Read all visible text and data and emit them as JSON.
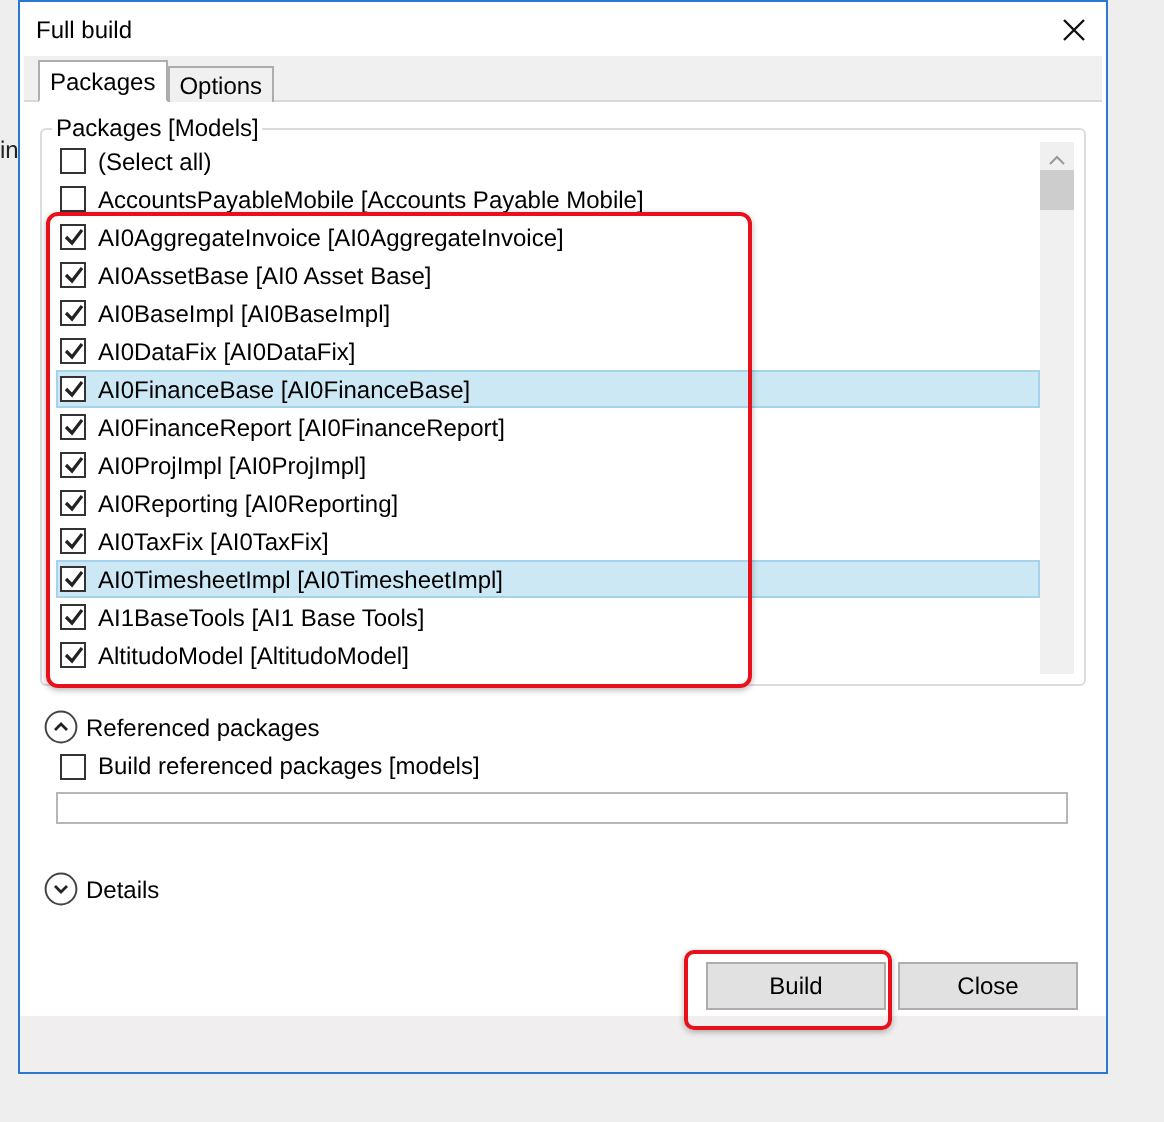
{
  "background": {
    "text": "in"
  },
  "window": {
    "title": "Full build"
  },
  "tabs": [
    {
      "label": "Packages",
      "selected": true
    },
    {
      "label": "Options",
      "selected": false
    }
  ],
  "packages": {
    "title": "Packages [Models]",
    "items": [
      {
        "label": "(Select all)",
        "checked": false,
        "selected": false
      },
      {
        "label": "AccountsPayableMobile [Accounts Payable Mobile]",
        "checked": false,
        "selected": false
      },
      {
        "label": "AI0AggregateInvoice [AI0AggregateInvoice]",
        "checked": true,
        "selected": false
      },
      {
        "label": "AI0AssetBase [AI0 Asset Base]",
        "checked": true,
        "selected": false
      },
      {
        "label": "AI0BaseImpl [AI0BaseImpl]",
        "checked": true,
        "selected": false
      },
      {
        "label": "AI0DataFix [AI0DataFix]",
        "checked": true,
        "selected": false
      },
      {
        "label": "AI0FinanceBase [AI0FinanceBase]",
        "checked": true,
        "selected": true
      },
      {
        "label": "AI0FinanceReport [AI0FinanceReport]",
        "checked": true,
        "selected": false
      },
      {
        "label": "AI0ProjImpl [AI0ProjImpl]",
        "checked": true,
        "selected": false
      },
      {
        "label": "AI0Reporting [AI0Reporting]",
        "checked": true,
        "selected": false
      },
      {
        "label": "AI0TaxFix [AI0TaxFix]",
        "checked": true,
        "selected": false
      },
      {
        "label": "AI0TimesheetImpl [AI0TimesheetImpl]",
        "checked": true,
        "selected": true
      },
      {
        "label": "AI1BaseTools [AI1 Base Tools]",
        "checked": true,
        "selected": false
      },
      {
        "label": "AltitudoModel [AltitudoModel]",
        "checked": true,
        "selected": false
      }
    ],
    "highlighted": true
  },
  "referenced": {
    "title": "Referenced packages",
    "expanded": true,
    "option": {
      "label": "Build referenced packages [models]",
      "checked": false
    }
  },
  "details": {
    "title": "Details",
    "expanded": false
  },
  "buttons": [
    {
      "label": "Build",
      "highlighted": true
    },
    {
      "label": "Close",
      "highlighted": false
    }
  ]
}
